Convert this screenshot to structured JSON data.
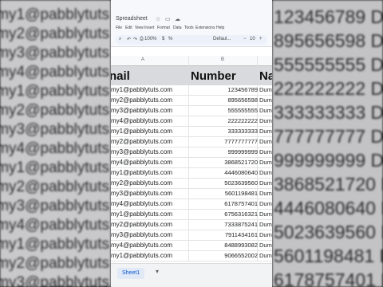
{
  "background_left_rows": [
    "my1@pabblytuts",
    "my2@pabblytuts",
    "my3@pabblytuts",
    "my4@pabblytuts",
    "my1@pabblytuts",
    "my2@pabblytuts",
    "my3@pabblytuts",
    "my4@pabblytuts",
    "my1@pabblytuts",
    "my2@pabblytuts",
    "my3@pabblytuts",
    "my4@pabblytuts",
    "my1@pabblytuts",
    "my2@pabblytuts",
    "my3@pabblytuts"
  ],
  "background_right_rows": [
    "123456789  Dum",
    "895656598  Dum",
    "555555555  Dum",
    "222222222  Dum",
    "333333333  Dum",
    "777777777  Dum",
    "999999999  Dum",
    "3868521720  Dum",
    "4446080640  Dum",
    "5023639560  Dum",
    "5601198481  Dum",
    "6178757401  Dum"
  ],
  "toolbar": {
    "doc_title": "Spreadsheet",
    "menu": [
      "File",
      "Edit",
      "View",
      "Insert",
      "Format",
      "Data",
      "Tools",
      "Extensions",
      "Help"
    ],
    "zoom": "100%",
    "font": "Defaul..."
  },
  "columns": {
    "a": "A",
    "b": "B"
  },
  "headers": {
    "email": "nail",
    "number": "Number",
    "name": "Na"
  },
  "rows": [
    {
      "email": "my1@pabblytuts.com",
      "number": "123456789",
      "name": "Dummy"
    },
    {
      "email": "my2@pabblytuts.com",
      "number": "895656598",
      "name": "Dummy"
    },
    {
      "email": "my3@pabblytuts.com",
      "number": "555555555",
      "name": "Dummy"
    },
    {
      "email": "my4@pabblytuts.com",
      "number": "222222222",
      "name": "Dummy"
    },
    {
      "email": "my1@pabblytuts.com",
      "number": "333333333",
      "name": "Dummy"
    },
    {
      "email": "my2@pabblytuts.com",
      "number": "7777777777",
      "name": "Dummy"
    },
    {
      "email": "my3@pabblytuts.com",
      "number": "999999999",
      "name": "Dummy"
    },
    {
      "email": "my4@pabblytuts.com",
      "number": "3868521720",
      "name": "Dummy"
    },
    {
      "email": "my1@pabblytuts.com",
      "number": "4446080640",
      "name": "Dummy"
    },
    {
      "email": "my2@pabblytuts.com",
      "number": "5023639560",
      "name": "Dummy"
    },
    {
      "email": "my3@pabblytuts.com",
      "number": "5601198481",
      "name": "Dummy"
    },
    {
      "email": "my4@pabblytuts.com",
      "number": "6178757401",
      "name": "Dummy"
    },
    {
      "email": "my1@pabblytuts.com",
      "number": "6756316321",
      "name": "Dummy"
    },
    {
      "email": "my2@pabblytuts.com",
      "number": "7333875241",
      "name": "Dummy"
    },
    {
      "email": "my3@pabblytuts.com",
      "number": "7911434161",
      "name": "Dummy"
    },
    {
      "email": "my4@pabblytuts.com",
      "number": "8488993082",
      "name": "Dummy"
    },
    {
      "email": "my1@pabblytuts.com",
      "number": "9066552002",
      "name": "Dummy"
    }
  ],
  "sheet_tab": "Sheet1",
  "colors": {
    "header_bg": "#d9dadd",
    "sheet_tab": "#0b57d0"
  }
}
